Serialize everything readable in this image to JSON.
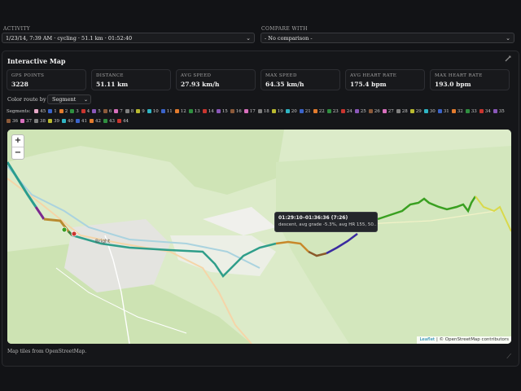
{
  "activity": {
    "label": "ACTIVITY",
    "value": "1/23/14, 7:39 AM · cycling · 51.1 km · 01:52:40"
  },
  "compare": {
    "label": "COMPARE WITH",
    "value": "- No comparison -"
  },
  "panel": {
    "title": "Interactive Map",
    "stats": [
      {
        "label": "GPS POINTS",
        "value": "3228"
      },
      {
        "label": "DISTANCE",
        "value": "51.11 km"
      },
      {
        "label": "AVG SPEED",
        "value": "27.93 km/h"
      },
      {
        "label": "MAX SPEED",
        "value": "64.35 km/h"
      },
      {
        "label": "AVG HEART RATE",
        "value": "175.4 bpm"
      },
      {
        "label": "MAX HEART RATE",
        "value": "193.0 bpm"
      }
    ],
    "color_by_label": "Color route by",
    "color_by_value": "Segment",
    "segments_label": "Segments:",
    "segments": [
      {
        "n": "45",
        "c": "#e8a9c8"
      },
      {
        "n": "1",
        "c": "#3a63c9"
      },
      {
        "n": "2",
        "c": "#e27b2e"
      },
      {
        "n": "3",
        "c": "#2f8f3f"
      },
      {
        "n": "4",
        "c": "#c9352f"
      },
      {
        "n": "5",
        "c": "#8a57b9"
      },
      {
        "n": "6",
        "c": "#8c5a3a"
      },
      {
        "n": "7",
        "c": "#d86fbd"
      },
      {
        "n": "8",
        "c": "#7f7f7f"
      },
      {
        "n": "9",
        "c": "#b9b92f"
      },
      {
        "n": "10",
        "c": "#2fb5c4"
      },
      {
        "n": "11",
        "c": "#3a63c9"
      },
      {
        "n": "12",
        "c": "#e27b2e"
      },
      {
        "n": "13",
        "c": "#2f8f3f"
      },
      {
        "n": "14",
        "c": "#c9352f"
      },
      {
        "n": "15",
        "c": "#8a57b9"
      },
      {
        "n": "16",
        "c": "#8c5a3a"
      },
      {
        "n": "17",
        "c": "#d86fbd"
      },
      {
        "n": "18",
        "c": "#7f7f7f"
      },
      {
        "n": "19",
        "c": "#b9b92f"
      },
      {
        "n": "20",
        "c": "#2fb5c4"
      },
      {
        "n": "21",
        "c": "#3a63c9"
      },
      {
        "n": "22",
        "c": "#e27b2e"
      },
      {
        "n": "23",
        "c": "#2f8f3f"
      },
      {
        "n": "24",
        "c": "#c9352f"
      },
      {
        "n": "25",
        "c": "#8a57b9"
      },
      {
        "n": "26",
        "c": "#8c5a3a"
      },
      {
        "n": "27",
        "c": "#d86fbd"
      },
      {
        "n": "28",
        "c": "#7f7f7f"
      },
      {
        "n": "29",
        "c": "#b9b92f"
      },
      {
        "n": "30",
        "c": "#2fb5c4"
      },
      {
        "n": "31",
        "c": "#3a63c9"
      },
      {
        "n": "32",
        "c": "#e27b2e"
      },
      {
        "n": "33",
        "c": "#2f8f3f"
      },
      {
        "n": "34",
        "c": "#c9352f"
      },
      {
        "n": "35",
        "c": "#8a57b9"
      },
      {
        "n": "36",
        "c": "#8c5a3a"
      },
      {
        "n": "37",
        "c": "#d86fbd"
      },
      {
        "n": "38",
        "c": "#7f7f7f"
      },
      {
        "n": "39",
        "c": "#b9b92f"
      },
      {
        "n": "40",
        "c": "#2fb5c4"
      },
      {
        "n": "41",
        "c": "#3a63c9"
      },
      {
        "n": "42",
        "c": "#e27b2e"
      },
      {
        "n": "43",
        "c": "#2f8f3f"
      },
      {
        "n": "44",
        "c": "#c9352f"
      }
    ],
    "map": {
      "zoom_in": "+",
      "zoom_out": "−",
      "tooltip_title": "01:29:10–01:36:36 (7:26)",
      "tooltip_body": "descent, avg grade -5.3%, avg HR 155, 50...",
      "attrib_link": "Leaflet",
      "attrib_text": "| © OpenStreetMap contributors",
      "place_town": "Bright"
    },
    "footer_note": "Map tiles from OpenStreetMap."
  }
}
